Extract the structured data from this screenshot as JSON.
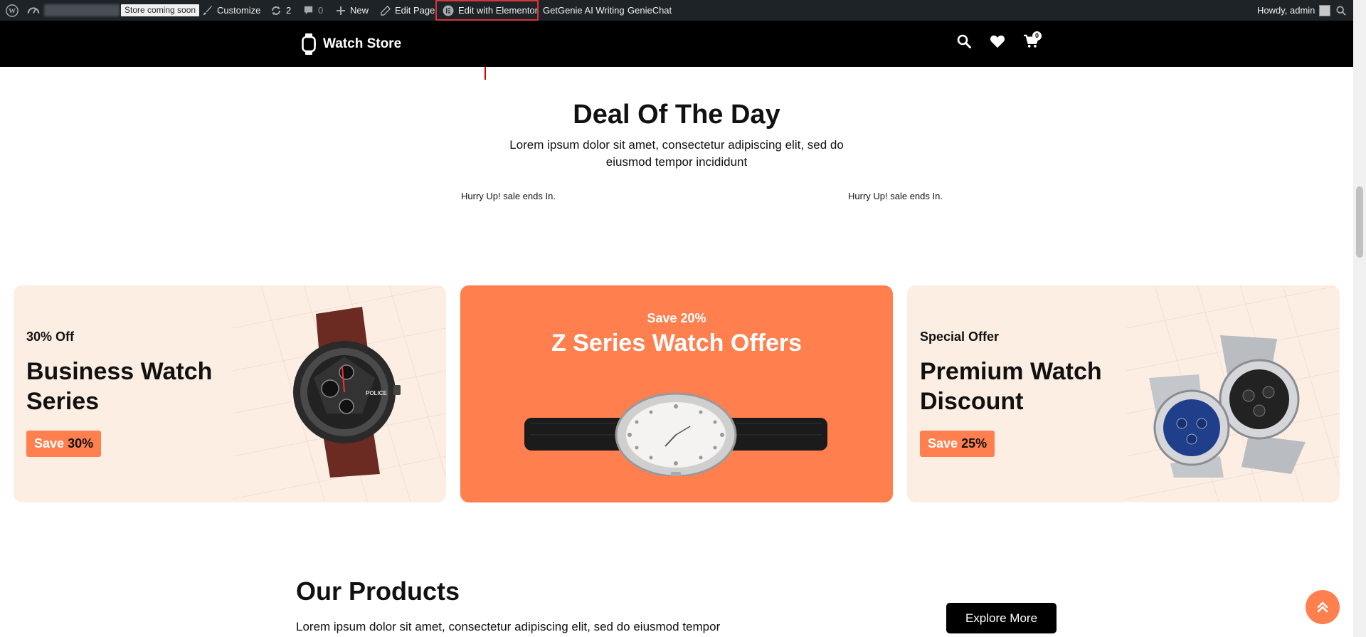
{
  "admin_bar": {
    "store_badge": "Store coming soon",
    "customize": "Customize",
    "updates_count": "2",
    "comments_count": "0",
    "new": "New",
    "edit_page": "Edit Page",
    "edit_elementor": "Edit with Elementor",
    "getgenie": "GetGenie AI Writing",
    "geniechat": "GenieChat",
    "howdy": "Howdy, admin"
  },
  "header": {
    "brand": "Watch Store",
    "cart_count": "0"
  },
  "deal": {
    "title": "Deal Of The Day",
    "description": "Lorem ipsum dolor sit amet, consectetur adipiscing elit, sed do eiusmod tempor incididunt",
    "timer_left": "Hurry Up! sale ends In.",
    "timer_right": "Hurry Up! sale ends In."
  },
  "banners": [
    {
      "kicker": "30% Off",
      "title": "Business Watch Series",
      "save_label": "Save",
      "save_pct": "30%"
    },
    {
      "kicker": "Save 20%",
      "title": "Z Series Watch Offers"
    },
    {
      "kicker": "Special Offer",
      "title": "Premium Watch Discount",
      "save_label": "Save",
      "save_pct": "25%"
    }
  ],
  "products": {
    "title": "Our Products",
    "description": "Lorem ipsum dolor sit amet, consectetur adipiscing elit, sed do eiusmod tempor",
    "explore": "Explore More"
  },
  "colors": {
    "accent": "#ff7f4e",
    "banner_light": "#fdeee4",
    "admin_bar": "#1d2327",
    "highlight": "#d63638"
  }
}
